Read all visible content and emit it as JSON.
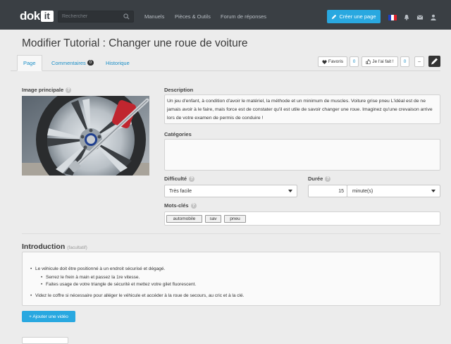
{
  "nav": {
    "logo_text": "dok",
    "logo_box": "it",
    "search_placeholder": "Rechercher",
    "links": [
      "Manuels",
      "Pièces & Outils",
      "Forum de réponses"
    ],
    "create_label": "Créer une page",
    "flag_colors": [
      "#1f3fbf",
      "#ffffff",
      "#e0202a"
    ]
  },
  "page": {
    "title": "Modifier Tutorial : Changer une roue de voiture",
    "tabs": [
      {
        "label": "Page"
      },
      {
        "label": "Commentaires",
        "badge": "0"
      },
      {
        "label": "Historique"
      }
    ],
    "actions": {
      "favoris_label": "Favoris",
      "favoris_count": "0",
      "done_label": "Je l'ai fait !",
      "done_count": "0",
      "minus_label": "–"
    }
  },
  "form": {
    "image_label": "Image principale",
    "description_label": "Description",
    "description_text": "Un jeu d'enfant, à condition d'avoir le matériel, la méthode et un minimum de muscles. Voiture grise pneu L'idéal est de ne jamais avoir à le faire, mais force est de constater qu'il est utile de savoir changer une roue. Imaginez qu'une crevaison arrive lors de votre examen de permis de conduire !",
    "categories_label": "Catégories",
    "difficulty_label": "Difficulté",
    "difficulty_value": "Très facile",
    "duration_label": "Durée",
    "duration_amount": "15",
    "duration_unit": "minute(s)",
    "keywords_label": "Mots-clés",
    "keywords": [
      "automobile",
      "sav",
      "pneu"
    ]
  },
  "intro": {
    "title": "Introduction",
    "optional": "(facultatif)",
    "bullets": [
      "Le véhicule doit être positionné à un endroit sécurisé et dégagé.",
      "Serrez le frein à main et passez la 1re vitesse.",
      "Faites usage de votre triangle de sécurité et mettez votre gilet fluorescent.",
      "Videz le coffre si nécessaire pour alléger le véhicule et accéder à la roue de secours, au cric et à la clé."
    ],
    "add_video_label": "+ Ajouter une vidéo"
  },
  "colors": {
    "accent": "#29a8e0",
    "nav_bg": "#3a3f44",
    "brake_caliper": "#c0262f"
  }
}
